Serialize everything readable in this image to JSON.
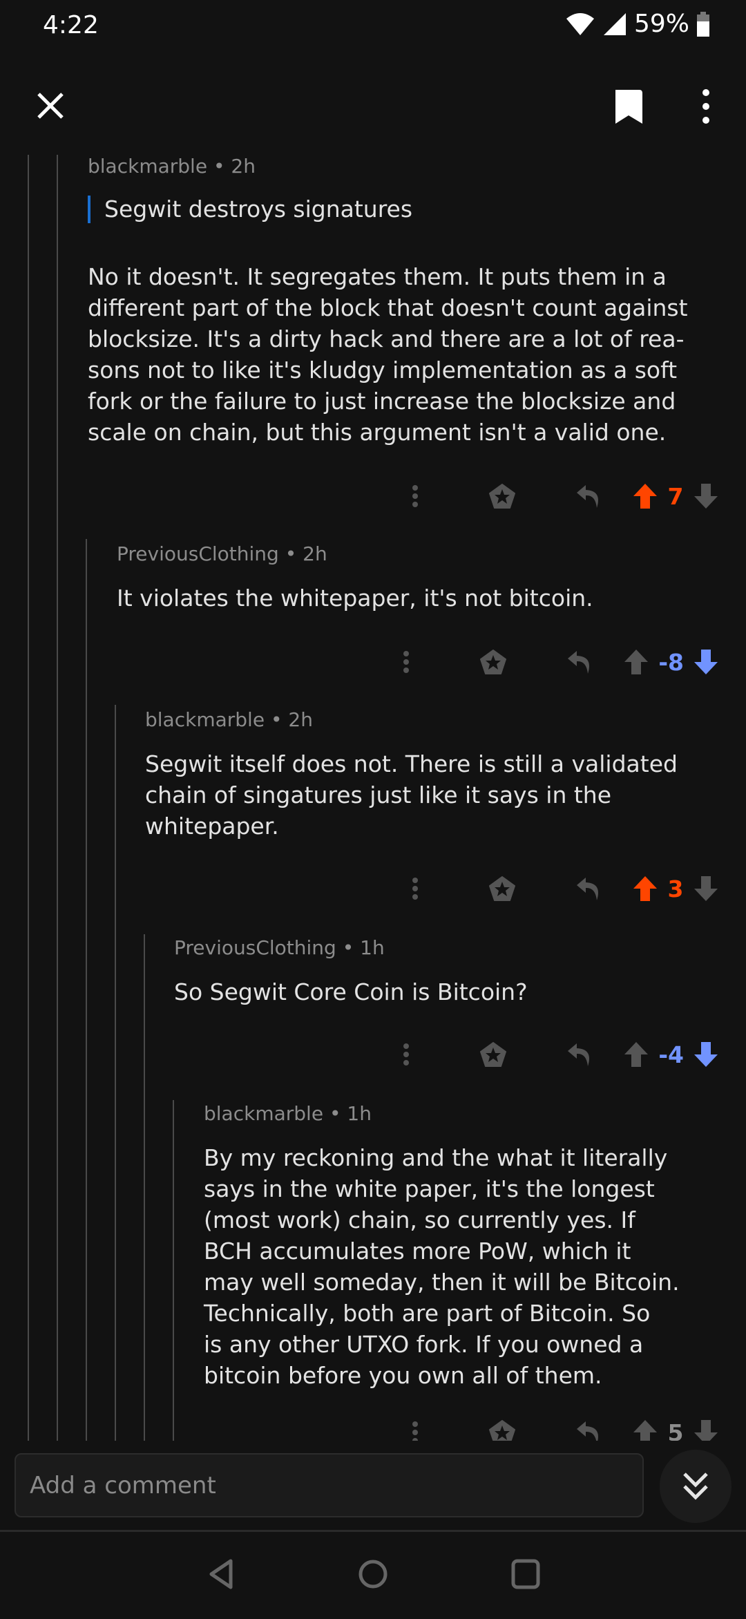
{
  "status_bar": {
    "time": "4:22",
    "battery": "59%"
  },
  "toolbar": {
    "close_icon": "close-icon",
    "bookmark_icon": "bookmark-icon",
    "more_icon": "more-vertical-icon"
  },
  "colors": {
    "upvote": "#ff4500",
    "downvote": "#7193ff",
    "icon": "#555555",
    "quote_bar": "#1a6fd1"
  },
  "comments": [
    {
      "author": "blackmarble",
      "age": "2h",
      "quote": "Segwit destroys signatures",
      "body_lines": [
        "No it doesn't. It segregates them.  It puts them in a",
        "different part of the block that doesn't count against",
        "blocksize.  It's a dirty hack and there are a lot of rea-",
        "sons not to like it's kludgy implementation as a soft",
        "fork or the failure to just increase the blocksize and",
        "scale on chain, but this argument isn't a valid one."
      ],
      "score": "7",
      "vote": "up"
    },
    {
      "author": "PreviousClothing",
      "age": "2h",
      "body_lines": [
        "It violates the whitepaper, it's not bitcoin."
      ],
      "score": "-8",
      "vote": "down"
    },
    {
      "author": "blackmarble",
      "age": "2h",
      "body_lines": [
        "Segwit itself does not.  There is still a validated",
        "chain of singatures just like it says in the",
        "whitepaper."
      ],
      "score": "3",
      "vote": "up"
    },
    {
      "author": "PreviousClothing",
      "age": "1h",
      "body_lines": [
        "So Segwit Core Coin is Bitcoin?"
      ],
      "score": "-4",
      "vote": "down"
    },
    {
      "author": "blackmarble",
      "age": "1h",
      "body_lines": [
        "By my reckoning and the what it literally",
        "says in the white paper, it's the longest",
        "(most work) chain, so currently yes.  If",
        "BCH accumulates more PoW, which it",
        "may well someday, then it will be Bitcoin.",
        "Technically, both are part of Bitcoin.  So",
        "is any other UTXO fork.  If you owned a",
        "bitcoin before you own all of them."
      ],
      "score": "5",
      "vote": "none"
    }
  ],
  "composer": {
    "placeholder": "Add a comment"
  }
}
